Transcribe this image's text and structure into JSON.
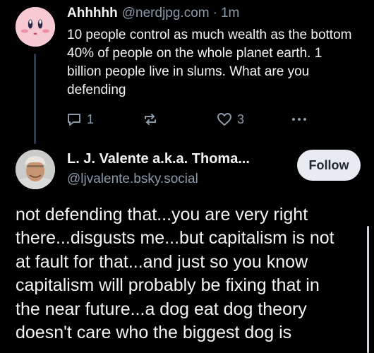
{
  "post1": {
    "display_name": "Ahhhhh",
    "handle": "@nerdjpg.com",
    "separator": "·",
    "time": "1m",
    "text": "10 people control as much wealth as the bottom 40% of people on the whole planet earth. 1 billion people live in slums. What are you defending",
    "reply_count": "1",
    "like_count": "3",
    "icons": [
      "reply-icon",
      "repost-icon",
      "like-icon",
      "more-icon"
    ]
  },
  "post2": {
    "display_name": "L. J. Valente a.k.a. Thoma...",
    "handle": "@ljvalente.bsky.social",
    "follow_label": "Follow",
    "text": "not defending that...you are very right there...disgusts me...but capitalism is not at fault for that...and just so you know capitalism will probably be fixing that in the near future...a dog eat dog theory doesn't care who the biggest dog is"
  },
  "colors": {
    "background": "#000000",
    "text": "#f1f3f5",
    "muted": "#8c9aa8",
    "follow_bg": "#e8ecf0"
  }
}
